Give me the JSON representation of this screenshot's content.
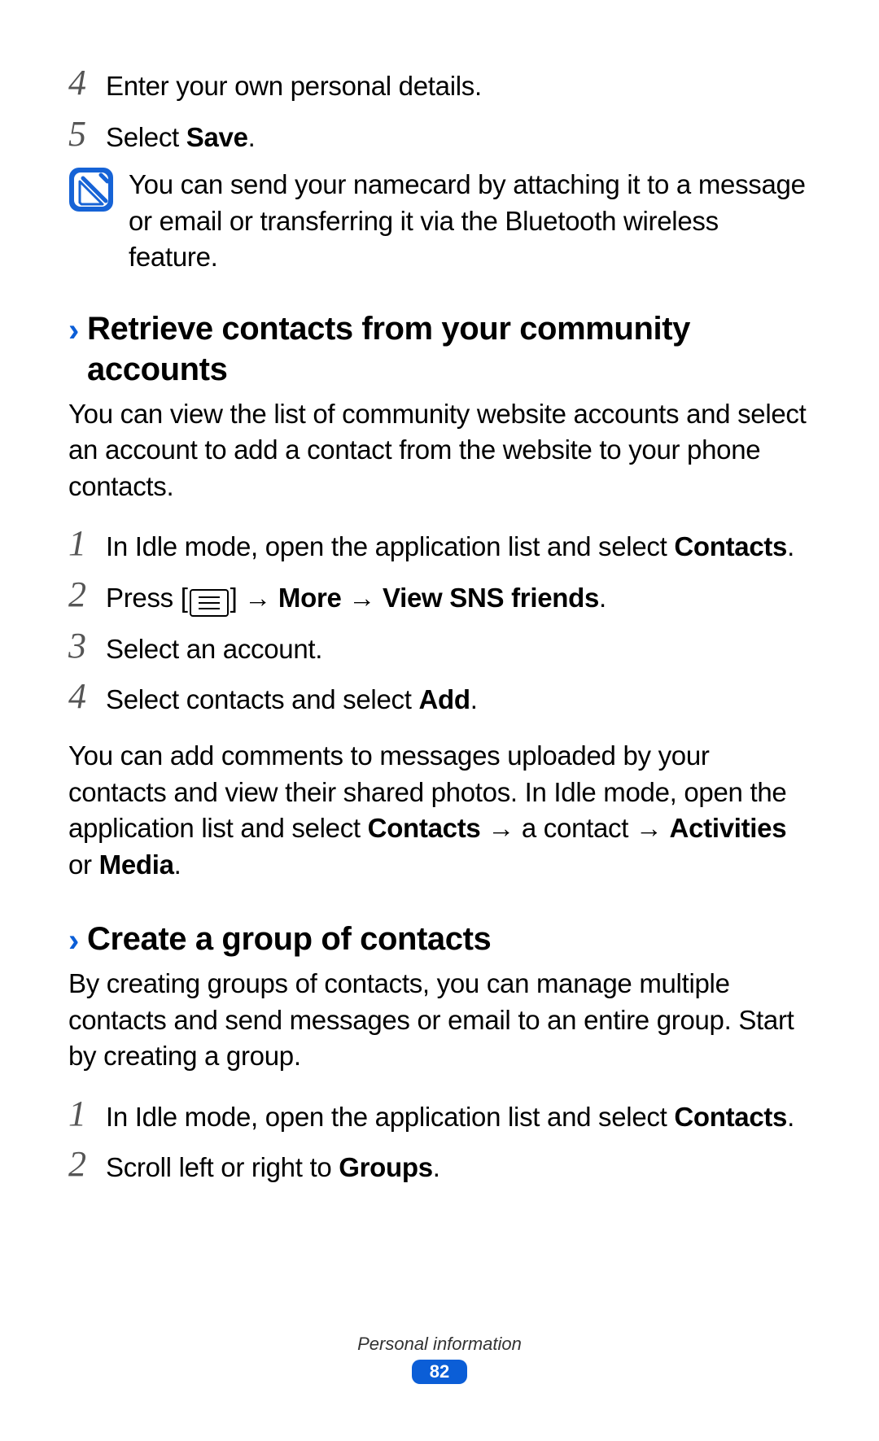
{
  "steps_top": [
    {
      "num": "4",
      "text": "Enter your own personal details."
    },
    {
      "num": "5",
      "text_prefix": "Select ",
      "bold": "Save",
      "text_suffix": "."
    }
  ],
  "note": {
    "text": "You can send your namecard by attaching it to a message or email or transferring it via the Bluetooth wireless feature."
  },
  "section1": {
    "title": "Retrieve contacts from your community accounts",
    "intro": "You can view the list of community website accounts and select an account to add a contact from the website to your phone contacts.",
    "steps": [
      {
        "num": "1",
        "pre": "In Idle mode, open the application list and select ",
        "bold": "Contacts",
        "post": "."
      },
      {
        "num": "2",
        "press_pre": "Press [",
        "press_post": "] → ",
        "bold1": "More",
        "arrow": " → ",
        "bold2": "View SNS friends",
        "end": "."
      },
      {
        "num": "3",
        "text": "Select an account."
      },
      {
        "num": "4",
        "pre": "Select contacts and select ",
        "bold": "Add",
        "post": "."
      }
    ],
    "outro": {
      "p1": "You can add comments to messages uploaded by your contacts and view their shared photos. In Idle mode, open the application list and select ",
      "b1": "Contacts",
      "p2": " → a contact → ",
      "b2": "Activities",
      "p3": " or ",
      "b3": "Media",
      "p4": "."
    }
  },
  "section2": {
    "title": "Create a group of contacts",
    "intro": "By creating groups of contacts, you can manage multiple contacts and send messages or email to an entire group. Start by creating a group.",
    "steps": [
      {
        "num": "1",
        "pre": "In Idle mode, open the application list and select ",
        "bold": "Contacts",
        "post": "."
      },
      {
        "num": "2",
        "pre": "Scroll left or right to ",
        "bold": "Groups",
        "post": "."
      }
    ]
  },
  "footer": {
    "section_name": "Personal information",
    "page_number": "82"
  }
}
